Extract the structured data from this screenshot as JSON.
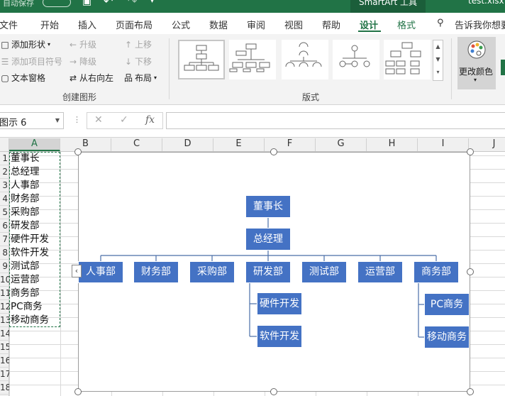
{
  "titlebar": {
    "autosave": "自动保存",
    "tool_group": "SmartArt 工具",
    "filename": "test.xlsx"
  },
  "tabs": [
    {
      "label": "文件"
    },
    {
      "label": "开始"
    },
    {
      "label": "插入"
    },
    {
      "label": "页面布局"
    },
    {
      "label": "公式"
    },
    {
      "label": "数据"
    },
    {
      "label": "审阅"
    },
    {
      "label": "视图"
    },
    {
      "label": "帮助"
    },
    {
      "label": "设计",
      "active": true
    },
    {
      "label": "格式"
    }
  ],
  "tell_me": "告诉我你想要",
  "ribbon": {
    "create_group": {
      "label": "创建图形",
      "add_shape": "添加形状",
      "add_bullet": "添加项目符号",
      "text_pane": "文本窗格",
      "promote": "升级",
      "demote": "降级",
      "right_to_left": "从右向左",
      "move_up": "上移",
      "move_down": "下移",
      "layout": "布局"
    },
    "layouts_group": {
      "label": "版式"
    },
    "change_colors": "更改颜色"
  },
  "formula_bar": {
    "name_box": "图示 6",
    "formula": ""
  },
  "columns": [
    "A",
    "B",
    "C",
    "D",
    "E",
    "F",
    "G",
    "H",
    "I",
    "J"
  ],
  "rows": [
    "1",
    "2",
    "3",
    "4",
    "5",
    "6",
    "7",
    "8",
    "9",
    "10",
    "11",
    "12",
    "13",
    "14",
    "15",
    "16",
    "17",
    "18"
  ],
  "cells_A": [
    "董事长",
    "总经理",
    "人事部",
    "财务部",
    "采购部",
    "研发部",
    "硬件开发",
    "软件开发",
    "测试部",
    "运营部",
    "商务部",
    "PC商务",
    "移动商务"
  ],
  "smartart": {
    "chairman": "董事长",
    "general_manager": "总经理",
    "departments": [
      "人事部",
      "财务部",
      "采购部",
      "研发部",
      "测试部",
      "运营部",
      "商务部"
    ],
    "rd_children": [
      "硬件开发",
      "软件开发"
    ],
    "biz_children": [
      "PC商务",
      "移动商务"
    ],
    "node_color": "#4472c4",
    "connector_color": "#4a6ea8"
  },
  "colors": {
    "accent": "#217346"
  }
}
